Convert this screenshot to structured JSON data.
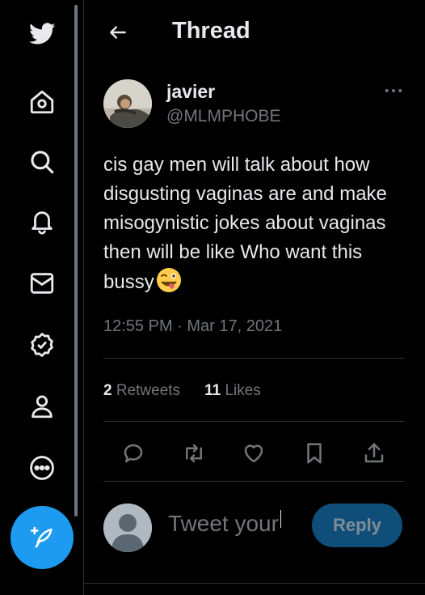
{
  "header": {
    "title": "Thread"
  },
  "tweet": {
    "display_name": "javier",
    "handle": "@MLMPHOBE",
    "text": "cis gay men will talk about how disgusting vaginas are and make misogynistic jokes about vaginas then will be like Who want this bussy",
    "emoji": "winking-face-with-tongue",
    "timestamp": "12:55 PM · Mar 17, 2021",
    "retweets": {
      "count": "2",
      "label": "Retweets"
    },
    "likes": {
      "count": "11",
      "label": "Likes"
    }
  },
  "reply": {
    "placeholder": "Tweet your",
    "button_label": "Reply"
  },
  "colors": {
    "accent": "#1d9bf0",
    "background": "#000000",
    "text": "#e7e9ea",
    "muted": "#71767b"
  }
}
